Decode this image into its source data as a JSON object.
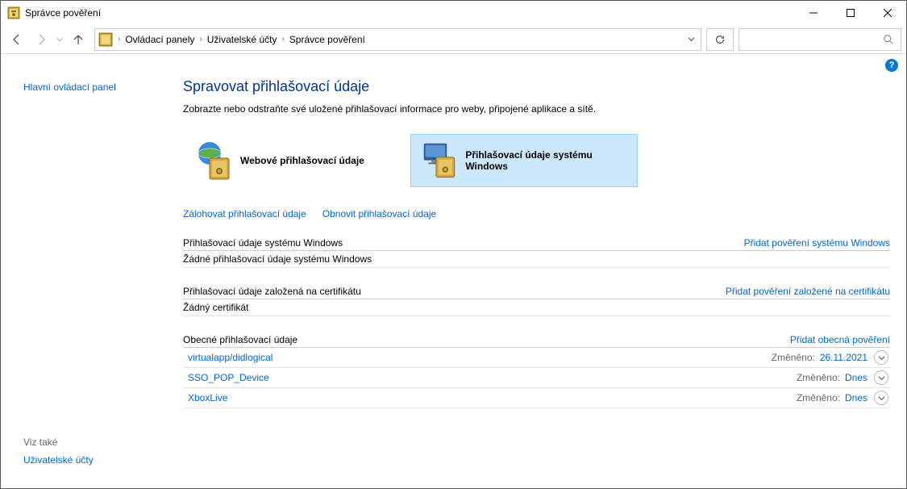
{
  "window": {
    "title": "Správce pověření"
  },
  "breadcrumb": {
    "items": [
      "Ovládací panely",
      "Uživatelské účty",
      "Správce pověření"
    ]
  },
  "sidebar": {
    "main_link": "Hlavní ovládací panel",
    "footer_title": "Viz také",
    "footer_link": "Uživatelské účty"
  },
  "page": {
    "title": "Spravovat přihlašovací údaje",
    "description": "Zobrazte nebo odstraňte své uložené přihlašovací informace pro weby, připojené aplikace a sítě."
  },
  "cred_types": {
    "web": "Webové přihlašovací údaje",
    "windows": "Přihlašovací údaje systému Windows"
  },
  "actions": {
    "backup": "Zálohovat přihlašovací údaje",
    "restore": "Obnovit přihlašovací údaje"
  },
  "sections": {
    "windows": {
      "title": "Přihlašovací údaje systému Windows",
      "add": "Přidat pověření systému Windows",
      "empty": "Žádné přihlašovací údaje systému Windows"
    },
    "certificate": {
      "title": "Přihlašovací údaje založená na certifikátu",
      "add": "Přidat pověření založené na certifikátu",
      "empty": "Žádný certifikát"
    },
    "generic": {
      "title": "Obecné přihlašovací údaje",
      "add": "Přidat obecná pověření",
      "modified_label": "Změněno:",
      "items": [
        {
          "name": "virtualapp/didlogical",
          "modified": "26.11.2021"
        },
        {
          "name": "SSO_POP_Device",
          "modified": "Dnes"
        },
        {
          "name": "XboxLive",
          "modified": "Dnes"
        }
      ]
    }
  }
}
